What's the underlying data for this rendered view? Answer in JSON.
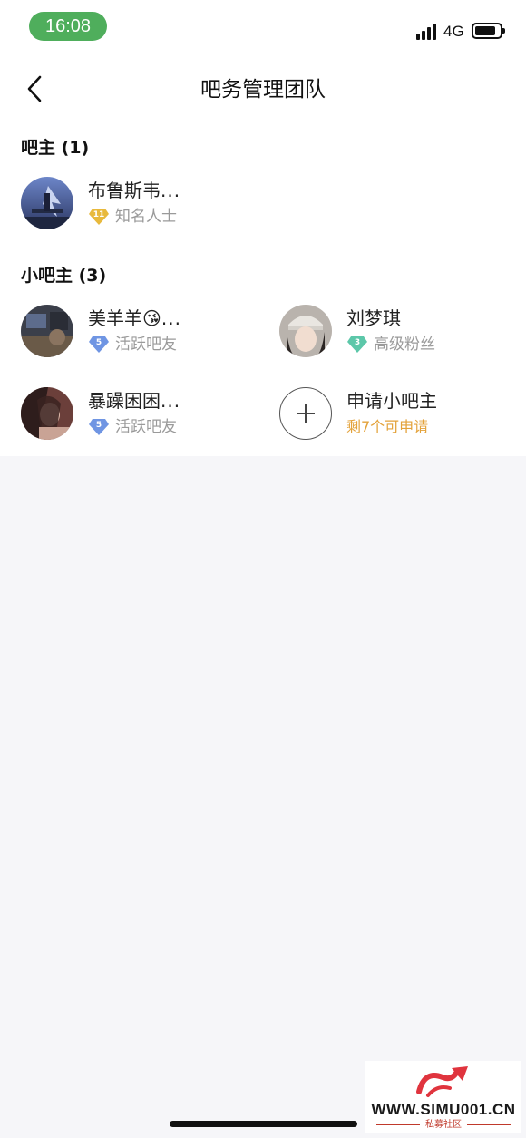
{
  "status_bar": {
    "time": "16:08",
    "network": "4G",
    "battery_level": 0.75
  },
  "nav": {
    "title": "吧务管理团队"
  },
  "sections": {
    "owner": {
      "title": "吧主 (1)",
      "members": [
        {
          "name": "布鲁斯韦",
          "ellipsis": "...",
          "level": "11",
          "level_color": "#e8b93c",
          "badge": "知名人士"
        }
      ]
    },
    "assistants": {
      "title": "小吧主 (3)",
      "members": [
        {
          "name": "美羊羊😘",
          "ellipsis": "...",
          "level": "5",
          "level_color": "#6f95e3",
          "badge": "活跃吧友"
        },
        {
          "name": "刘梦琪",
          "level": "3",
          "level_color": "#5cc7a9",
          "badge": "高级粉丝"
        },
        {
          "name": "暴躁困困",
          "ellipsis": "...",
          "level": "5",
          "level_color": "#6f95e3",
          "badge": "活跃吧友"
        }
      ],
      "apply": {
        "label": "申请小吧主",
        "remaining": "剩7个可申请",
        "accent": "#e3a23a"
      }
    }
  },
  "watermark": {
    "url": "WWW.SIMU001.CN",
    "subtitle": "私募社区"
  }
}
